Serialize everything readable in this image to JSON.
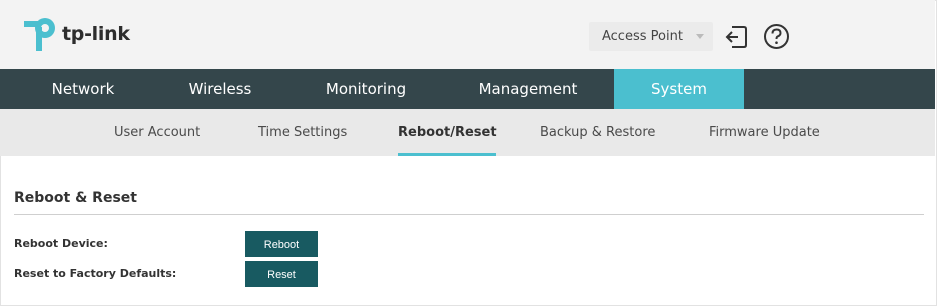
{
  "header": {
    "brand": "tp-link",
    "mode_select": {
      "value": "Access Point"
    },
    "logout_icon": "logout-icon",
    "help_icon": "help-icon"
  },
  "main_nav": {
    "tabs": [
      {
        "label": "Network"
      },
      {
        "label": "Wireless"
      },
      {
        "label": "Monitoring"
      },
      {
        "label": "Management"
      },
      {
        "label": "System",
        "active": true
      }
    ]
  },
  "sub_nav": {
    "tabs": [
      {
        "label": "User Account"
      },
      {
        "label": "Time Settings"
      },
      {
        "label": "Reboot/Reset",
        "active": true
      },
      {
        "label": "Backup & Restore"
      },
      {
        "label": "Firmware Update"
      }
    ]
  },
  "content": {
    "section_title": "Reboot & Reset",
    "reboot_label": "Reboot Device:",
    "reboot_button": "Reboot",
    "reset_label": "Reset to Factory Defaults:",
    "reset_button": "Reset"
  },
  "colors": {
    "accent": "#4bbfcf",
    "nav_bg": "#34464b",
    "button": "#185a61"
  }
}
